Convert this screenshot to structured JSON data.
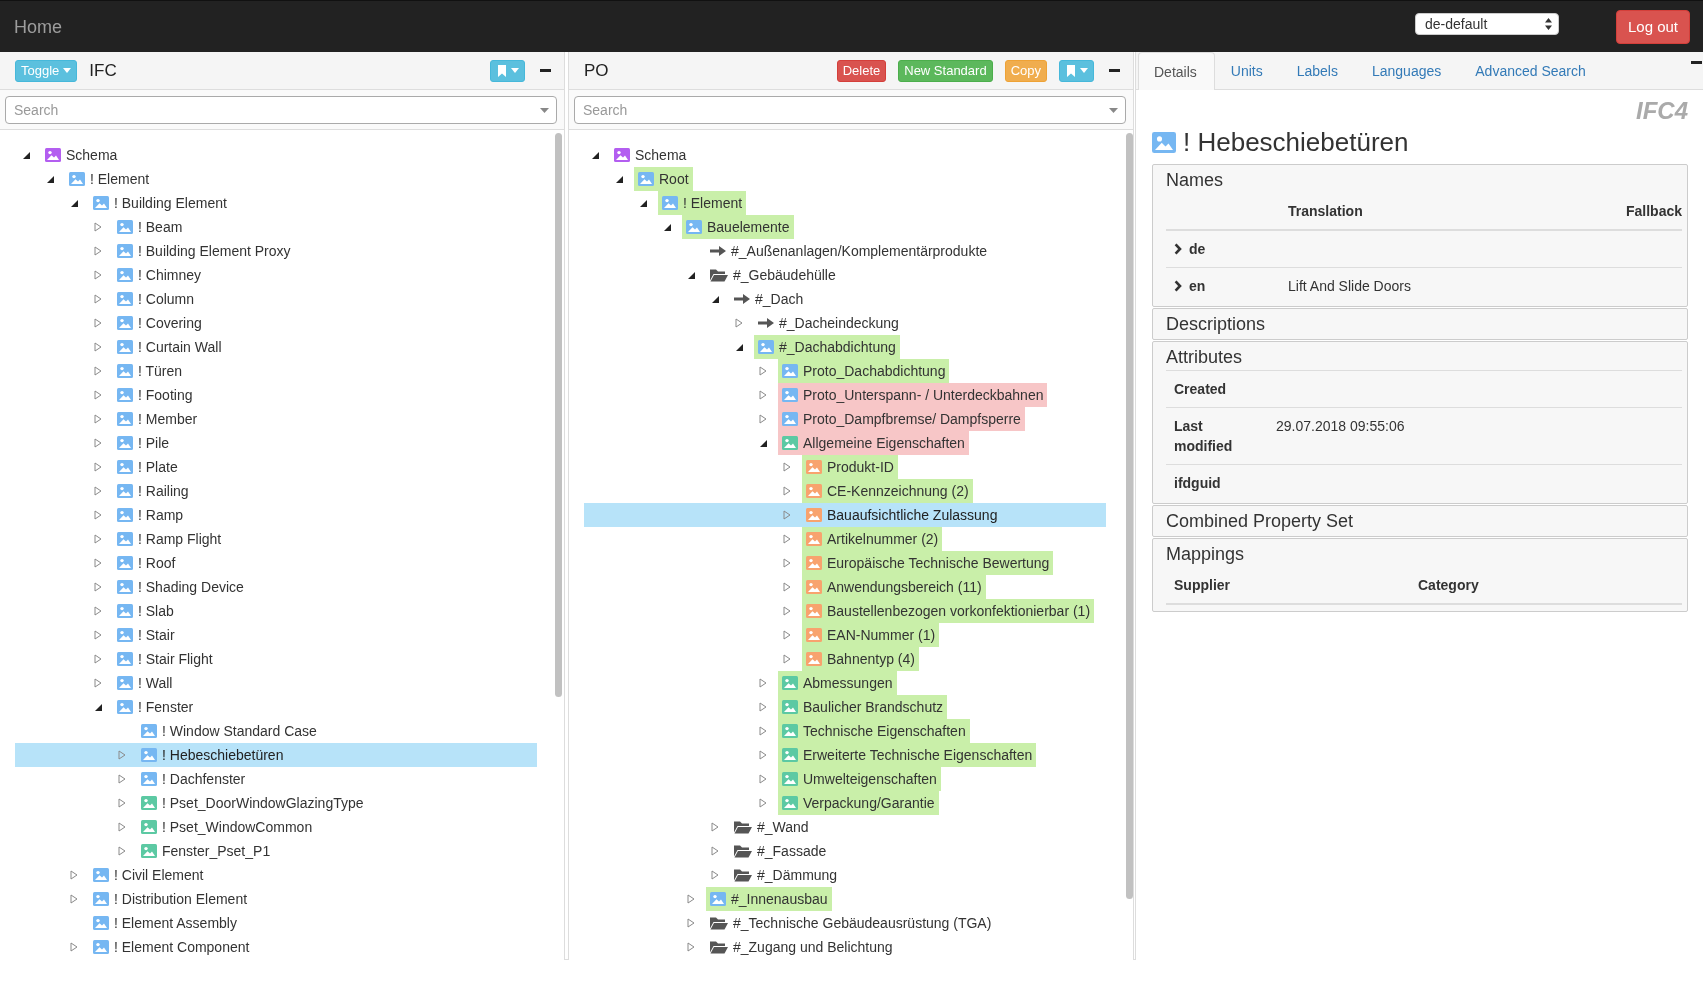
{
  "navbar": {
    "brand": "Home",
    "language_select": "de-default",
    "logout_button": "Log out"
  },
  "left_panel": {
    "toggle_button": "Toggle",
    "title": "IFC",
    "search": {
      "placeholder": "Search"
    },
    "tree": [
      {
        "label": "Schema",
        "icon": {
          "kind": "image",
          "color": "#b35ef0"
        },
        "expanded": true,
        "selected": false,
        "children": [
          {
            "label": "! Element",
            "icon": {
              "kind": "image",
              "color": "#76b7f2"
            },
            "expanded": true,
            "selected": false,
            "children": [
              {
                "label": "! Building Element",
                "icon": {
                  "kind": "image",
                  "color": "#76b7f2"
                },
                "expanded": true,
                "selected": false,
                "children": [
                  {
                    "label": "! Beam",
                    "icon": {
                      "kind": "image",
                      "color": "#76b7f2"
                    },
                    "expanded": false,
                    "selected": false
                  },
                  {
                    "label": "! Building Element Proxy",
                    "icon": {
                      "kind": "image",
                      "color": "#76b7f2"
                    },
                    "expanded": false,
                    "selected": false
                  },
                  {
                    "label": "! Chimney",
                    "icon": {
                      "kind": "image",
                      "color": "#76b7f2"
                    },
                    "expanded": false,
                    "selected": false
                  },
                  {
                    "label": "! Column",
                    "icon": {
                      "kind": "image",
                      "color": "#76b7f2"
                    },
                    "expanded": false,
                    "selected": false
                  },
                  {
                    "label": "! Covering",
                    "icon": {
                      "kind": "image",
                      "color": "#76b7f2"
                    },
                    "expanded": false,
                    "selected": false
                  },
                  {
                    "label": "! Curtain Wall",
                    "icon": {
                      "kind": "image",
                      "color": "#76b7f2"
                    },
                    "expanded": false,
                    "selected": false
                  },
                  {
                    "label": "! Türen",
                    "icon": {
                      "kind": "image",
                      "color": "#76b7f2"
                    },
                    "expanded": false,
                    "selected": false
                  },
                  {
                    "label": "! Footing",
                    "icon": {
                      "kind": "image",
                      "color": "#76b7f2"
                    },
                    "expanded": false,
                    "selected": false
                  },
                  {
                    "label": "! Member",
                    "icon": {
                      "kind": "image",
                      "color": "#76b7f2"
                    },
                    "expanded": false,
                    "selected": false
                  },
                  {
                    "label": "! Pile",
                    "icon": {
                      "kind": "image",
                      "color": "#76b7f2"
                    },
                    "expanded": false,
                    "selected": false
                  },
                  {
                    "label": "! Plate",
                    "icon": {
                      "kind": "image",
                      "color": "#76b7f2"
                    },
                    "expanded": false,
                    "selected": false
                  },
                  {
                    "label": "! Railing",
                    "icon": {
                      "kind": "image",
                      "color": "#76b7f2"
                    },
                    "expanded": false,
                    "selected": false
                  },
                  {
                    "label": "! Ramp",
                    "icon": {
                      "kind": "image",
                      "color": "#76b7f2"
                    },
                    "expanded": false,
                    "selected": false
                  },
                  {
                    "label": "! Ramp Flight",
                    "icon": {
                      "kind": "image",
                      "color": "#76b7f2"
                    },
                    "expanded": false,
                    "selected": false
                  },
                  {
                    "label": "! Roof",
                    "icon": {
                      "kind": "image",
                      "color": "#76b7f2"
                    },
                    "expanded": false,
                    "selected": false
                  },
                  {
                    "label": "! Shading Device",
                    "icon": {
                      "kind": "image",
                      "color": "#76b7f2"
                    },
                    "expanded": false,
                    "selected": false
                  },
                  {
                    "label": "! Slab",
                    "icon": {
                      "kind": "image",
                      "color": "#76b7f2"
                    },
                    "expanded": false,
                    "selected": false
                  },
                  {
                    "label": "! Stair",
                    "icon": {
                      "kind": "image",
                      "color": "#76b7f2"
                    },
                    "expanded": false,
                    "selected": false
                  },
                  {
                    "label": "! Stair Flight",
                    "icon": {
                      "kind": "image",
                      "color": "#76b7f2"
                    },
                    "expanded": false,
                    "selected": false
                  },
                  {
                    "label": "! Wall",
                    "icon": {
                      "kind": "image",
                      "color": "#76b7f2"
                    },
                    "expanded": false,
                    "selected": false
                  },
                  {
                    "label": "! Fenster",
                    "icon": {
                      "kind": "image",
                      "color": "#76b7f2"
                    },
                    "expanded": true,
                    "selected": false,
                    "children": [
                      {
                        "label": "! Window Standard Case",
                        "icon": {
                          "kind": "image",
                          "color": "#76b7f2"
                        },
                        "selected": false
                      },
                      {
                        "label": "! Hebeschiebetüren",
                        "icon": {
                          "kind": "image",
                          "color": "#76b7f2"
                        },
                        "expanded": false,
                        "selected": true
                      },
                      {
                        "label": "! Dachfenster",
                        "icon": {
                          "kind": "image",
                          "color": "#76b7f2"
                        },
                        "expanded": false,
                        "selected": false
                      },
                      {
                        "label": "! Pset_DoorWindowGlazingType",
                        "icon": {
                          "kind": "image",
                          "color": "#5cc9a3"
                        },
                        "expanded": false,
                        "selected": false
                      },
                      {
                        "label": "! Pset_WindowCommon",
                        "icon": {
                          "kind": "image",
                          "color": "#5cc9a3"
                        },
                        "expanded": false,
                        "selected": false
                      },
                      {
                        "label": "Fenster_Pset_P1",
                        "icon": {
                          "kind": "image",
                          "color": "#5cc9a3"
                        },
                        "expanded": false,
                        "selected": false
                      }
                    ]
                  }
                ]
              },
              {
                "label": "! Civil Element",
                "icon": {
                  "kind": "image",
                  "color": "#76b7f2"
                },
                "expanded": false,
                "selected": false
              },
              {
                "label": "! Distribution Element",
                "icon": {
                  "kind": "image",
                  "color": "#76b7f2"
                },
                "expanded": false,
                "selected": false
              },
              {
                "label": "! Element Assembly",
                "icon": {
                  "kind": "image",
                  "color": "#76b7f2"
                },
                "selected": false
              },
              {
                "label": "! Element Component",
                "icon": {
                  "kind": "image",
                  "color": "#76b7f2"
                },
                "expanded": false,
                "selected": false
              }
            ]
          }
        ]
      }
    ]
  },
  "middle_panel": {
    "title": "PO",
    "buttons": [
      {
        "label": "Delete",
        "kind": "delete"
      },
      {
        "label": "New Standard",
        "kind": "create"
      },
      {
        "label": "Copy",
        "kind": "copy"
      }
    ],
    "search": {
      "placeholder": "Search"
    },
    "tree": [
      {
        "label": "Schema",
        "icon": {
          "kind": "image",
          "color": "#b35ef0"
        },
        "expanded": true,
        "selected": false,
        "children": [
          {
            "label": "Root",
            "icon": {
              "kind": "image",
              "color": "#76b7f2"
            },
            "color": "#c9efa9",
            "expanded": true,
            "selected": false,
            "children": [
              {
                "label": "! Element",
                "icon": {
                  "kind": "image",
                  "color": "#76b7f2"
                },
                "color": "#c9efa9",
                "expanded": true,
                "selected": false,
                "children": [
                  {
                    "label": "Bauelemente",
                    "icon": {
                      "kind": "image",
                      "color": "#76b7f2"
                    },
                    "color": "#c9efa9",
                    "expanded": true,
                    "selected": false,
                    "children": [
                      {
                        "label": "#_Außenanlagen/Komplementärprodukte",
                        "icon": {
                          "kind": "arrow"
                        },
                        "selected": false
                      },
                      {
                        "label": "#_Gebäudehülle",
                        "icon": {
                          "kind": "folder"
                        },
                        "expanded": true,
                        "selected": false,
                        "children": [
                          {
                            "label": "#_Dach",
                            "icon": {
                              "kind": "arrow"
                            },
                            "expanded": true,
                            "selected": false,
                            "children": [
                              {
                                "label": "#_Dacheindeckung",
                                "icon": {
                                  "kind": "arrow"
                                },
                                "expanded": false,
                                "selected": false
                              },
                              {
                                "label": "#_Dachabdichtung",
                                "icon": {
                                  "kind": "image",
                                  "color": "#76b7f2"
                                },
                                "color": "#c9efa9",
                                "expanded": true,
                                "selected": false,
                                "children": [
                                  {
                                    "label": "Proto_Dachabdichtung",
                                    "icon": {
                                      "kind": "image",
                                      "color": "#76b7f2"
                                    },
                                    "color": "#c9efa9",
                                    "expanded": false,
                                    "selected": false
                                  },
                                  {
                                    "label": "Proto_Unterspann- / Unterdeckbahnen",
                                    "icon": {
                                      "kind": "image",
                                      "color": "#76b7f2"
                                    },
                                    "color": "#f7c6c7",
                                    "expanded": false,
                                    "selected": false
                                  },
                                  {
                                    "label": "Proto_Dampfbremse/ Dampfsperre",
                                    "icon": {
                                      "kind": "image",
                                      "color": "#76b7f2"
                                    },
                                    "color": "#f7c6c7",
                                    "expanded": false,
                                    "selected": false
                                  },
                                  {
                                    "label": "Allgemeine Eigenschaften",
                                    "icon": {
                                      "kind": "image",
                                      "color": "#5cc9a3"
                                    },
                                    "color": "#f7c6c7",
                                    "expanded": true,
                                    "selected": false,
                                    "children": [
                                      {
                                        "label": "Produkt-ID",
                                        "icon": {
                                          "kind": "image",
                                          "color": "#f8a36e"
                                        },
                                        "color": "#c9efa9",
                                        "expanded": false,
                                        "selected": false
                                      },
                                      {
                                        "label": "CE-Kennzeichnung (2)",
                                        "icon": {
                                          "kind": "image",
                                          "color": "#f8a36e"
                                        },
                                        "color": "#c9efa9",
                                        "expanded": false,
                                        "selected": false
                                      },
                                      {
                                        "label": "Bauaufsichtliche Zulassung",
                                        "icon": {
                                          "kind": "image",
                                          "color": "#f8a36e"
                                        },
                                        "expanded": false,
                                        "selected": true
                                      },
                                      {
                                        "label": "Artikelnummer (2)",
                                        "icon": {
                                          "kind": "image",
                                          "color": "#f8a36e"
                                        },
                                        "color": "#c9efa9",
                                        "expanded": false,
                                        "selected": false
                                      },
                                      {
                                        "label": "Europäische Technische Bewertung",
                                        "icon": {
                                          "kind": "image",
                                          "color": "#f8a36e"
                                        },
                                        "color": "#c9efa9",
                                        "expanded": false,
                                        "selected": false
                                      },
                                      {
                                        "label": "Anwendungsbereich (11)",
                                        "icon": {
                                          "kind": "image",
                                          "color": "#f8a36e"
                                        },
                                        "color": "#c9efa9",
                                        "expanded": false,
                                        "selected": false
                                      },
                                      {
                                        "label": "Baustellenbezogen vorkonfektionierbar (1)",
                                        "icon": {
                                          "kind": "image",
                                          "color": "#f8a36e"
                                        },
                                        "color": "#c9efa9",
                                        "expanded": false,
                                        "selected": false
                                      },
                                      {
                                        "label": "EAN-Nummer (1)",
                                        "icon": {
                                          "kind": "image",
                                          "color": "#f8a36e"
                                        },
                                        "color": "#c9efa9",
                                        "expanded": false,
                                        "selected": false
                                      },
                                      {
                                        "label": "Bahnentyp (4)",
                                        "icon": {
                                          "kind": "image",
                                          "color": "#f8a36e"
                                        },
                                        "color": "#c9efa9",
                                        "expanded": false,
                                        "selected": false
                                      }
                                    ]
                                  },
                                  {
                                    "label": "Abmessungen",
                                    "icon": {
                                      "kind": "image",
                                      "color": "#5cc9a3"
                                    },
                                    "color": "#c9efa9",
                                    "expanded": false,
                                    "selected": false
                                  },
                                  {
                                    "label": "Baulicher Brandschutz",
                                    "icon": {
                                      "kind": "image",
                                      "color": "#5cc9a3"
                                    },
                                    "color": "#c9efa9",
                                    "expanded": false,
                                    "selected": false
                                  },
                                  {
                                    "label": "Technische Eigenschaften",
                                    "icon": {
                                      "kind": "image",
                                      "color": "#5cc9a3"
                                    },
                                    "color": "#c9efa9",
                                    "expanded": false,
                                    "selected": false
                                  },
                                  {
                                    "label": "Erweiterte Technische Eigenschaften",
                                    "icon": {
                                      "kind": "image",
                                      "color": "#5cc9a3"
                                    },
                                    "color": "#c9efa9",
                                    "expanded": false,
                                    "selected": false
                                  },
                                  {
                                    "label": "Umwelteigenschaften",
                                    "icon": {
                                      "kind": "image",
                                      "color": "#5cc9a3"
                                    },
                                    "color": "#c9efa9",
                                    "expanded": false,
                                    "selected": false
                                  },
                                  {
                                    "label": "Verpackung/Garantie",
                                    "icon": {
                                      "kind": "image",
                                      "color": "#5cc9a3"
                                    },
                                    "color": "#c9efa9",
                                    "expanded": false,
                                    "selected": false
                                  }
                                ]
                              }
                            ]
                          },
                          {
                            "label": "#_Wand",
                            "icon": {
                              "kind": "folder"
                            },
                            "expanded": false,
                            "selected": false
                          },
                          {
                            "label": "#_Fassade",
                            "icon": {
                              "kind": "folder"
                            },
                            "expanded": false,
                            "selected": false
                          },
                          {
                            "label": "#_Dämmung",
                            "icon": {
                              "kind": "folder"
                            },
                            "expanded": false,
                            "selected": false
                          }
                        ]
                      },
                      {
                        "label": "#_Innenausbau",
                        "icon": {
                          "kind": "image",
                          "color": "#76b7f2"
                        },
                        "color": "#c9efa9",
                        "expanded": false,
                        "selected": false
                      },
                      {
                        "label": "#_Technische Gebäudeausrüstung (TGA)",
                        "icon": {
                          "kind": "folder"
                        },
                        "expanded": false,
                        "selected": false
                      },
                      {
                        "label": "#_Zugang und Belichtung",
                        "icon": {
                          "kind": "folder"
                        },
                        "expanded": false,
                        "selected": false
                      }
                    ]
                  }
                ]
              }
            ]
          }
        ]
      }
    ]
  },
  "detail_panel": {
    "tabs": [
      {
        "label": "Details",
        "selected": true
      },
      {
        "label": "Units",
        "selected": false
      },
      {
        "label": "Labels",
        "selected": false
      },
      {
        "label": "Languages",
        "selected": false
      },
      {
        "label": "Advanced Search",
        "selected": false
      }
    ],
    "schema_label": "IFC4",
    "title": "! Hebeschiebetüren",
    "sections": [
      {
        "kind": "names",
        "title": "Names",
        "columns": [
          "Translation",
          "Fallback"
        ],
        "rows": [
          {
            "language": "de"
          },
          {
            "language": "en",
            "translation": "Lift And Slide Doors"
          }
        ]
      },
      {
        "kind": "plain",
        "title": "Descriptions"
      },
      {
        "kind": "attributes",
        "title": "Attributes",
        "rows": [
          {
            "label": "Created"
          },
          {
            "label": "Last modified",
            "value": "29.07.2018 09:55:06"
          },
          {
            "label": "ifdguid"
          }
        ]
      },
      {
        "kind": "plain",
        "title": "Combined Property Set"
      },
      {
        "kind": "mappings",
        "title": "Mappings",
        "columns": [
          "Supplier",
          "Category"
        ]
      }
    ]
  }
}
